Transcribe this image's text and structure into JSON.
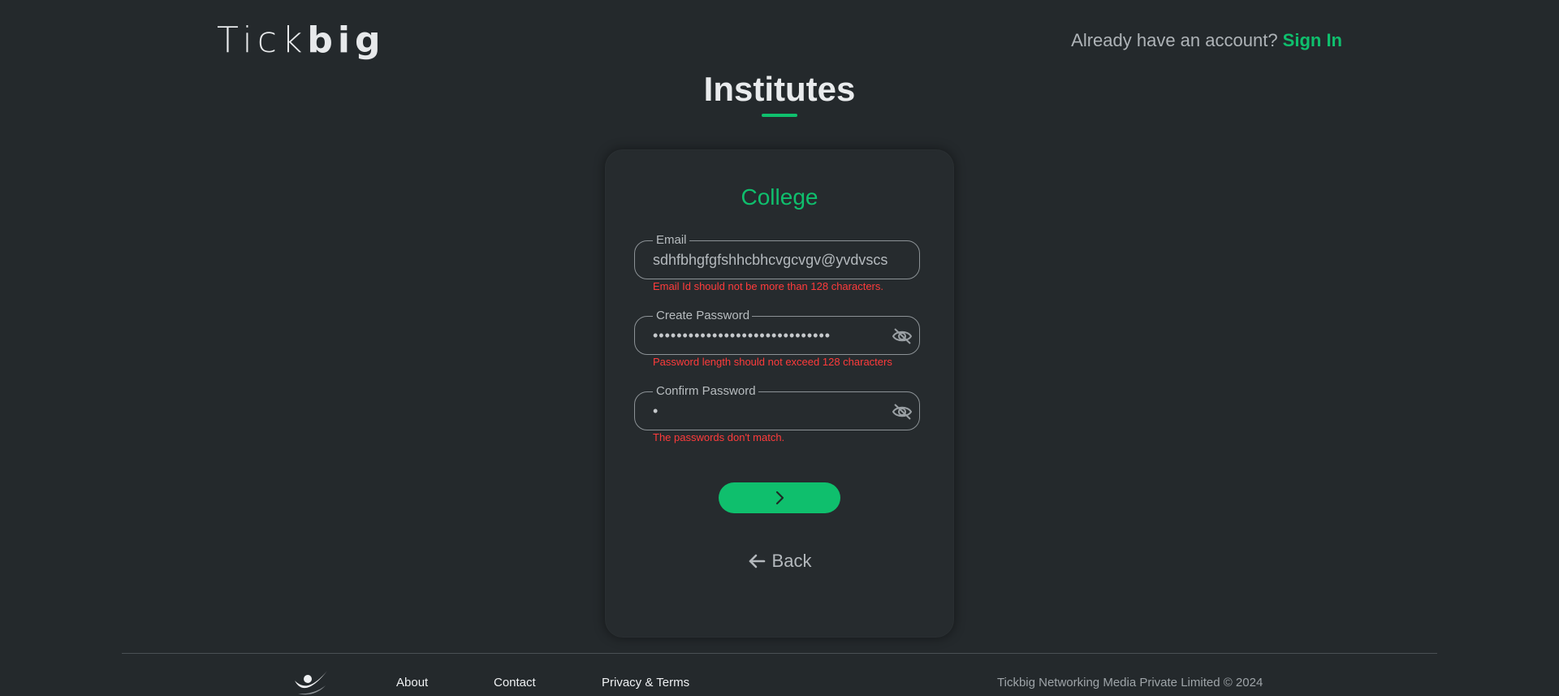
{
  "header": {
    "logo_light": "Tick",
    "logo_bold": "big",
    "signin_prompt": "Already have an account? ",
    "signin_link": "Sign In"
  },
  "page_title": "Institutes",
  "card": {
    "title": "College",
    "email": {
      "label": "Email",
      "value": "sdhfbhgfgfshhcbhcvgcvgv@yvdvscs",
      "error": "Email Id should not be more than 128 characters."
    },
    "create_password": {
      "label": "Create Password",
      "masked_value": "••••••••••••••••••••••••••••••",
      "error": "Password length should not exceed 128 characters"
    },
    "confirm_password": {
      "label": "Confirm Password",
      "masked_value": "•",
      "error": "The passwords don't match."
    },
    "back_label": "Back"
  },
  "footer": {
    "links": [
      "About",
      "Contact",
      "Privacy & Terms"
    ],
    "copyright": "Tickbig Networking Media Private Limited © 2024"
  },
  "colors": {
    "background": "#24292c",
    "accent": "#0fbf6d",
    "error": "#ff3b3b"
  },
  "icons": [
    "eye-off-icon",
    "chevron-right-icon",
    "arrow-left-icon",
    "tickbig-logo-icon"
  ]
}
